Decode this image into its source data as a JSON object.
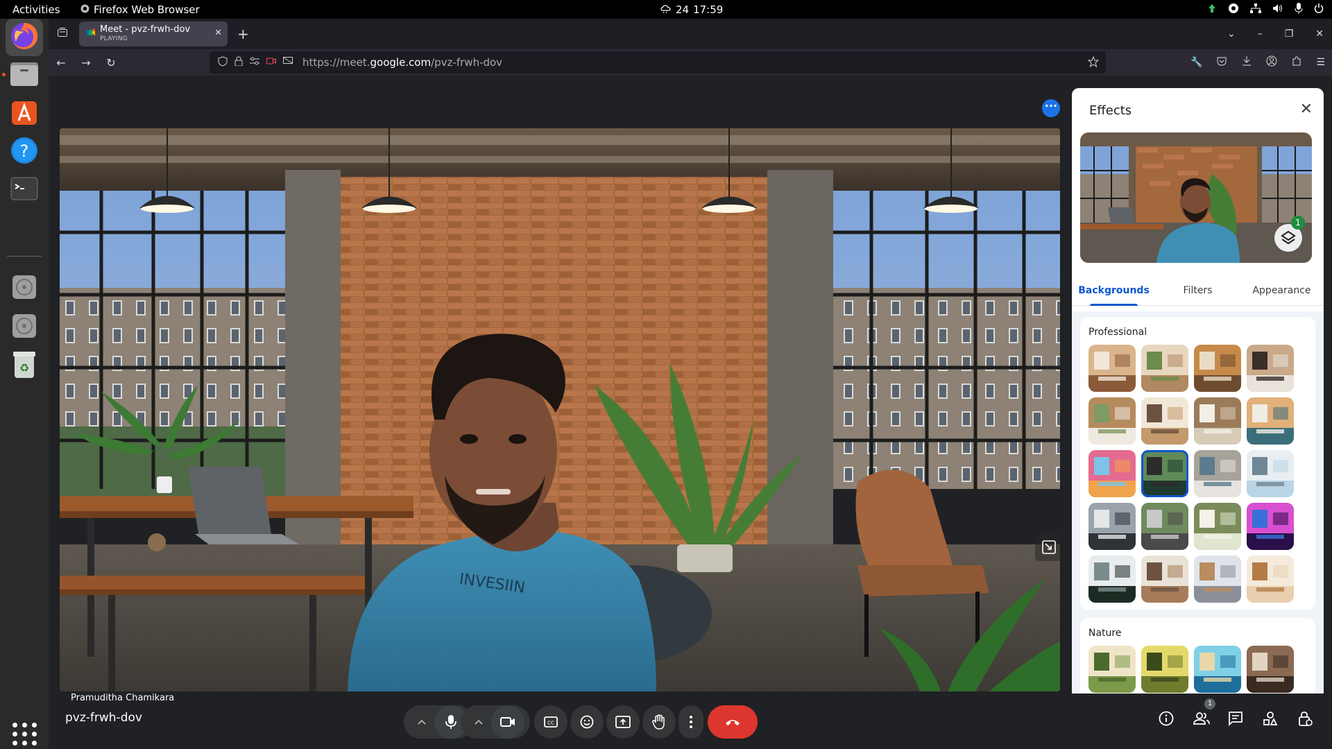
{
  "topbar": {
    "activities": "Activities",
    "app_name": "Firefox Web Browser",
    "date": "24",
    "time": "17:59"
  },
  "browser": {
    "tab": {
      "title": "Meet - pvz-frwh-dov",
      "status": "PLAYING"
    },
    "url_prefix": "https://meet.",
    "url_domain": "google.com",
    "url_path": "/pvz-frwh-dov"
  },
  "meet": {
    "participant_name": "Pramuditha Chamikara",
    "meeting_code": "pvz-frwh-dov",
    "people_count": "1"
  },
  "effects": {
    "title": "Effects",
    "applied_count": "1",
    "tabs": [
      {
        "label": "Backgrounds",
        "active": true
      },
      {
        "label": "Filters",
        "active": false
      },
      {
        "label": "Appearance",
        "active": false
      }
    ],
    "sections": [
      {
        "title": "Professional",
        "selected_index": 9,
        "thumb_count": 20
      },
      {
        "title": "Nature",
        "thumb_count": 4
      }
    ]
  },
  "colors": {
    "accent": "#0b57d0",
    "end_call": "#dc362e",
    "meet_bg": "#202124"
  }
}
